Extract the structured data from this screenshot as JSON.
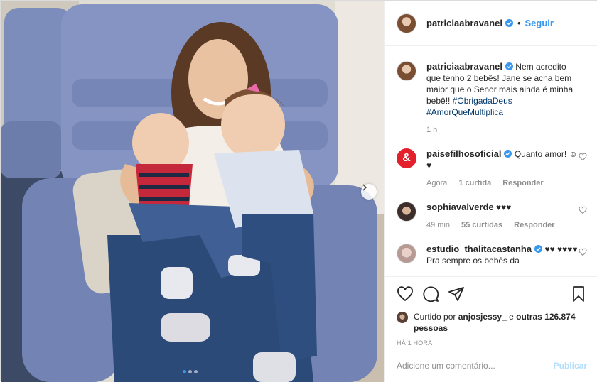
{
  "post": {
    "author": "patriciaabravanel",
    "follow_label": "Seguir",
    "separator": "•",
    "caption": {
      "username": "patriciaabravanel",
      "text": "Nem acredito que tenho 2 bebês! Jane se acha bem maior que o Senor mais ainda é minha bebê!!",
      "hashtag1": "#ObrigadaDeus",
      "hashtag2": "#AmorQueMultiplica",
      "time": "1 h"
    },
    "comments": [
      {
        "username": "paisefilhosoficial",
        "text": "Quanto amor! ☺♥",
        "time": "Agora",
        "likes": "1 curtida",
        "reply": "Responder"
      },
      {
        "username": "sophiavalverde",
        "text": "♥♥♥",
        "time": "49 min",
        "likes": "55 curtidas",
        "reply": "Responder"
      },
      {
        "username": "estudio_thalitacastanha",
        "text": "♥♥ ♥♥♥♥ Pra sempre os bebês da"
      }
    ],
    "liked_by": {
      "prefix": "Curtido por",
      "user": "anjosjessy_",
      "middle": "e",
      "others": "outras 126.874 pessoas"
    },
    "timestamp": "Há 1 hora",
    "add_comment_placeholder": "Adicione um comentário...",
    "publish_label": "Publicar",
    "carousel": {
      "slides": 3,
      "active": 1
    },
    "icons": [
      "heart-icon",
      "comment-icon",
      "share-icon",
      "bookmark-icon",
      "verified-icon",
      "chevron-right-icon"
    ],
    "colors": {
      "link": "#3897f0",
      "hashtag": "#00376b",
      "muted": "#8e8e8e",
      "publish_disabled": "#b2dffc"
    }
  }
}
